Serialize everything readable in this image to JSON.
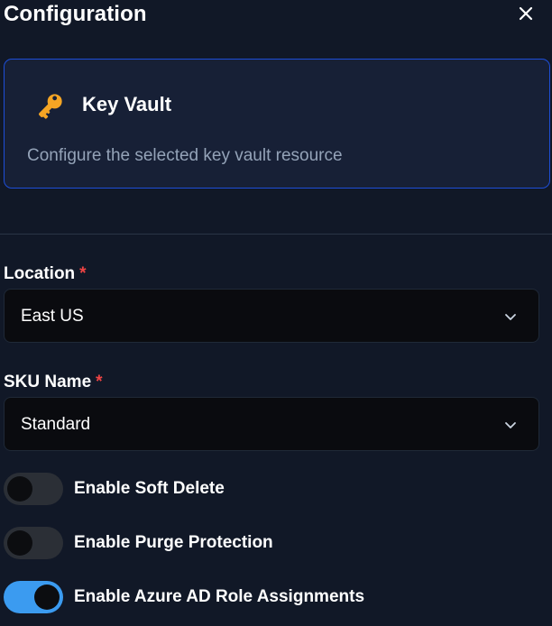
{
  "header": {
    "title": "Configuration"
  },
  "resource": {
    "icon": "key-icon",
    "name": "Key Vault",
    "description": "Configure the selected key vault resource"
  },
  "fields": {
    "location": {
      "label": "Location",
      "required_mark": "*",
      "value": "East US"
    },
    "sku": {
      "label": "SKU Name",
      "required_mark": "*",
      "value": "Standard"
    }
  },
  "toggles": [
    {
      "label": "Enable Soft Delete",
      "enabled": false
    },
    {
      "label": "Enable Purge Protection",
      "enabled": false
    },
    {
      "label": "Enable Azure AD Role Assignments",
      "enabled": true
    }
  ],
  "colors": {
    "background": "#111827",
    "card_border": "#1d4ed8",
    "required": "#ef4444",
    "toggle_on": "#3b9bf0",
    "toggle_off": "#2b2f36"
  }
}
